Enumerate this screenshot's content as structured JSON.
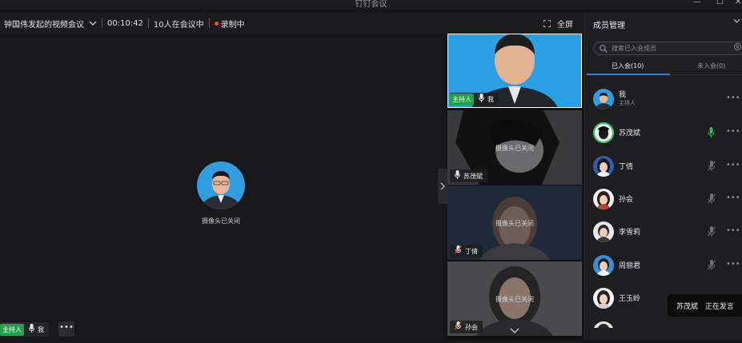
{
  "window": {
    "title": "钉钉会议",
    "minimize": "—",
    "maximize": "☐",
    "close": "✕"
  },
  "toolbar": {
    "meeting_title": "钟国伟发起的视频会议",
    "duration": "00:10:42",
    "attendee_count": "10人在会议中",
    "recording": "录制中",
    "fullscreen": "全屏"
  },
  "stage": {
    "camera_off": "摄像头已关闭",
    "host_badge": "主持人",
    "self_name": "我",
    "more": "•••"
  },
  "thumbnails": [
    {
      "name": "我",
      "host_badge": "主持人",
      "camera_off": "",
      "mic": "on"
    },
    {
      "name": "苏茂斌",
      "host_badge": "",
      "camera_off": "摄像头已关闭",
      "mic": "on"
    },
    {
      "name": "丁倩",
      "host_badge": "",
      "camera_off": "摄像头已关闭",
      "mic": "off"
    },
    {
      "name": "孙会",
      "host_badge": "",
      "camera_off": "摄像头已关闭",
      "mic": "off"
    }
  ],
  "panel": {
    "title": "成员管理",
    "search_placeholder": "搜索已入会成员",
    "tab_joined": "已入会(10)",
    "tab_not_joined": "未入会(0)",
    "members": [
      {
        "name": "我",
        "role": "主持人",
        "mic": "none"
      },
      {
        "name": "苏茂斌",
        "role": "",
        "mic": "speaking"
      },
      {
        "name": "丁倩",
        "role": "",
        "mic": "muted"
      },
      {
        "name": "孙会",
        "role": "",
        "mic": "muted"
      },
      {
        "name": "李雪莉",
        "role": "",
        "mic": "muted"
      },
      {
        "name": "周丽君",
        "role": "",
        "mic": "muted"
      },
      {
        "name": "王玉岭",
        "role": "",
        "mic": "muted"
      }
    ],
    "more": "•••"
  },
  "toast": {
    "speaker": "苏茂斌",
    "status": "正在发言"
  },
  "colors": {
    "host_green": "#1fa34a",
    "record_red": "#ef4a3a",
    "tab_blue": "#2f7fe8",
    "speaking_green": "#2fc25b"
  }
}
